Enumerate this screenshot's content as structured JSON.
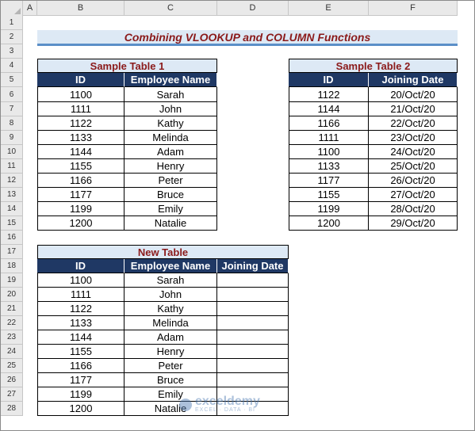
{
  "columns": [
    "A",
    "B",
    "C",
    "D",
    "E",
    "F"
  ],
  "rows": [
    "1",
    "2",
    "3",
    "4",
    "5",
    "6",
    "7",
    "8",
    "9",
    "10",
    "11",
    "12",
    "13",
    "14",
    "15",
    "16",
    "17",
    "18",
    "19",
    "20",
    "21",
    "22",
    "23",
    "24",
    "25",
    "26",
    "27",
    "28"
  ],
  "title": "Combining VLOOKUP and COLUMN Functions",
  "table1": {
    "title": "Sample Table 1",
    "headers": [
      "ID",
      "Employee Name"
    ],
    "rows": [
      [
        "1100",
        "Sarah"
      ],
      [
        "1111",
        "John"
      ],
      [
        "1122",
        "Kathy"
      ],
      [
        "1133",
        "Melinda"
      ],
      [
        "1144",
        "Adam"
      ],
      [
        "1155",
        "Henry"
      ],
      [
        "1166",
        "Peter"
      ],
      [
        "1177",
        "Bruce"
      ],
      [
        "1199",
        "Emily"
      ],
      [
        "1200",
        "Natalie"
      ]
    ]
  },
  "table2": {
    "title": "Sample Table 2",
    "headers": [
      "ID",
      "Joining Date"
    ],
    "rows": [
      [
        "1122",
        "20/Oct/20"
      ],
      [
        "1144",
        "21/Oct/20"
      ],
      [
        "1166",
        "22/Oct/20"
      ],
      [
        "1111",
        "23/Oct/20"
      ],
      [
        "1100",
        "24/Oct/20"
      ],
      [
        "1133",
        "25/Oct/20"
      ],
      [
        "1177",
        "26/Oct/20"
      ],
      [
        "1155",
        "27/Oct/20"
      ],
      [
        "1199",
        "28/Oct/20"
      ],
      [
        "1200",
        "29/Oct/20"
      ]
    ]
  },
  "table3": {
    "title": "New Table",
    "headers": [
      "ID",
      "Employee Name",
      "Joining Date"
    ],
    "rows": [
      [
        "1100",
        "Sarah",
        ""
      ],
      [
        "1111",
        "John",
        ""
      ],
      [
        "1122",
        "Kathy",
        ""
      ],
      [
        "1133",
        "Melinda",
        ""
      ],
      [
        "1144",
        "Adam",
        ""
      ],
      [
        "1155",
        "Henry",
        ""
      ],
      [
        "1166",
        "Peter",
        ""
      ],
      [
        "1177",
        "Bruce",
        ""
      ],
      [
        "1199",
        "Emily",
        ""
      ],
      [
        "1200",
        "Natalie",
        ""
      ]
    ]
  },
  "watermark": {
    "name": "exceldemy",
    "tagline": "EXCEL · DATA · BI"
  }
}
